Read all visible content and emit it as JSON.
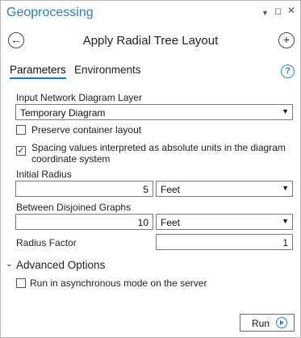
{
  "pane": {
    "title": "Geoprocessing",
    "menu_glyph": "▼",
    "restore_glyph": "◻",
    "close_glyph": "✕"
  },
  "tool": {
    "title": "Apply Radial Tree Layout",
    "back_glyph": "←",
    "add_glyph": "+"
  },
  "tabs": {
    "parameters": "Parameters",
    "environments": "Environments",
    "help_glyph": "?"
  },
  "params": {
    "input_layer": {
      "label": "Input Network Diagram Layer",
      "value": "Temporary Diagram"
    },
    "preserve_container": {
      "label": "Preserve container layout",
      "checked": false
    },
    "spacing_absolute": {
      "label_line1": "Spacing values interpreted as absolute units in the diagram",
      "label_line2": "coordinate system",
      "checked": true,
      "check_glyph": "✓"
    },
    "initial_radius": {
      "label": "Initial Radius",
      "value": "5",
      "unit": "Feet"
    },
    "between_graphs": {
      "label": "Between Disjoined Graphs",
      "value": "10",
      "unit": "Feet"
    },
    "radius_factor": {
      "label": "Radius Factor",
      "value": "1"
    }
  },
  "advanced": {
    "title": "Advanced Options",
    "chevron_glyph": "⌄",
    "async": {
      "label": "Run in asynchronous mode on the server",
      "checked": false
    }
  },
  "run": {
    "label": "Run"
  },
  "arrow_glyph": "▼",
  "colors": {
    "accent": "#2f7fc1",
    "tab_underline": "#2a6fb0"
  }
}
